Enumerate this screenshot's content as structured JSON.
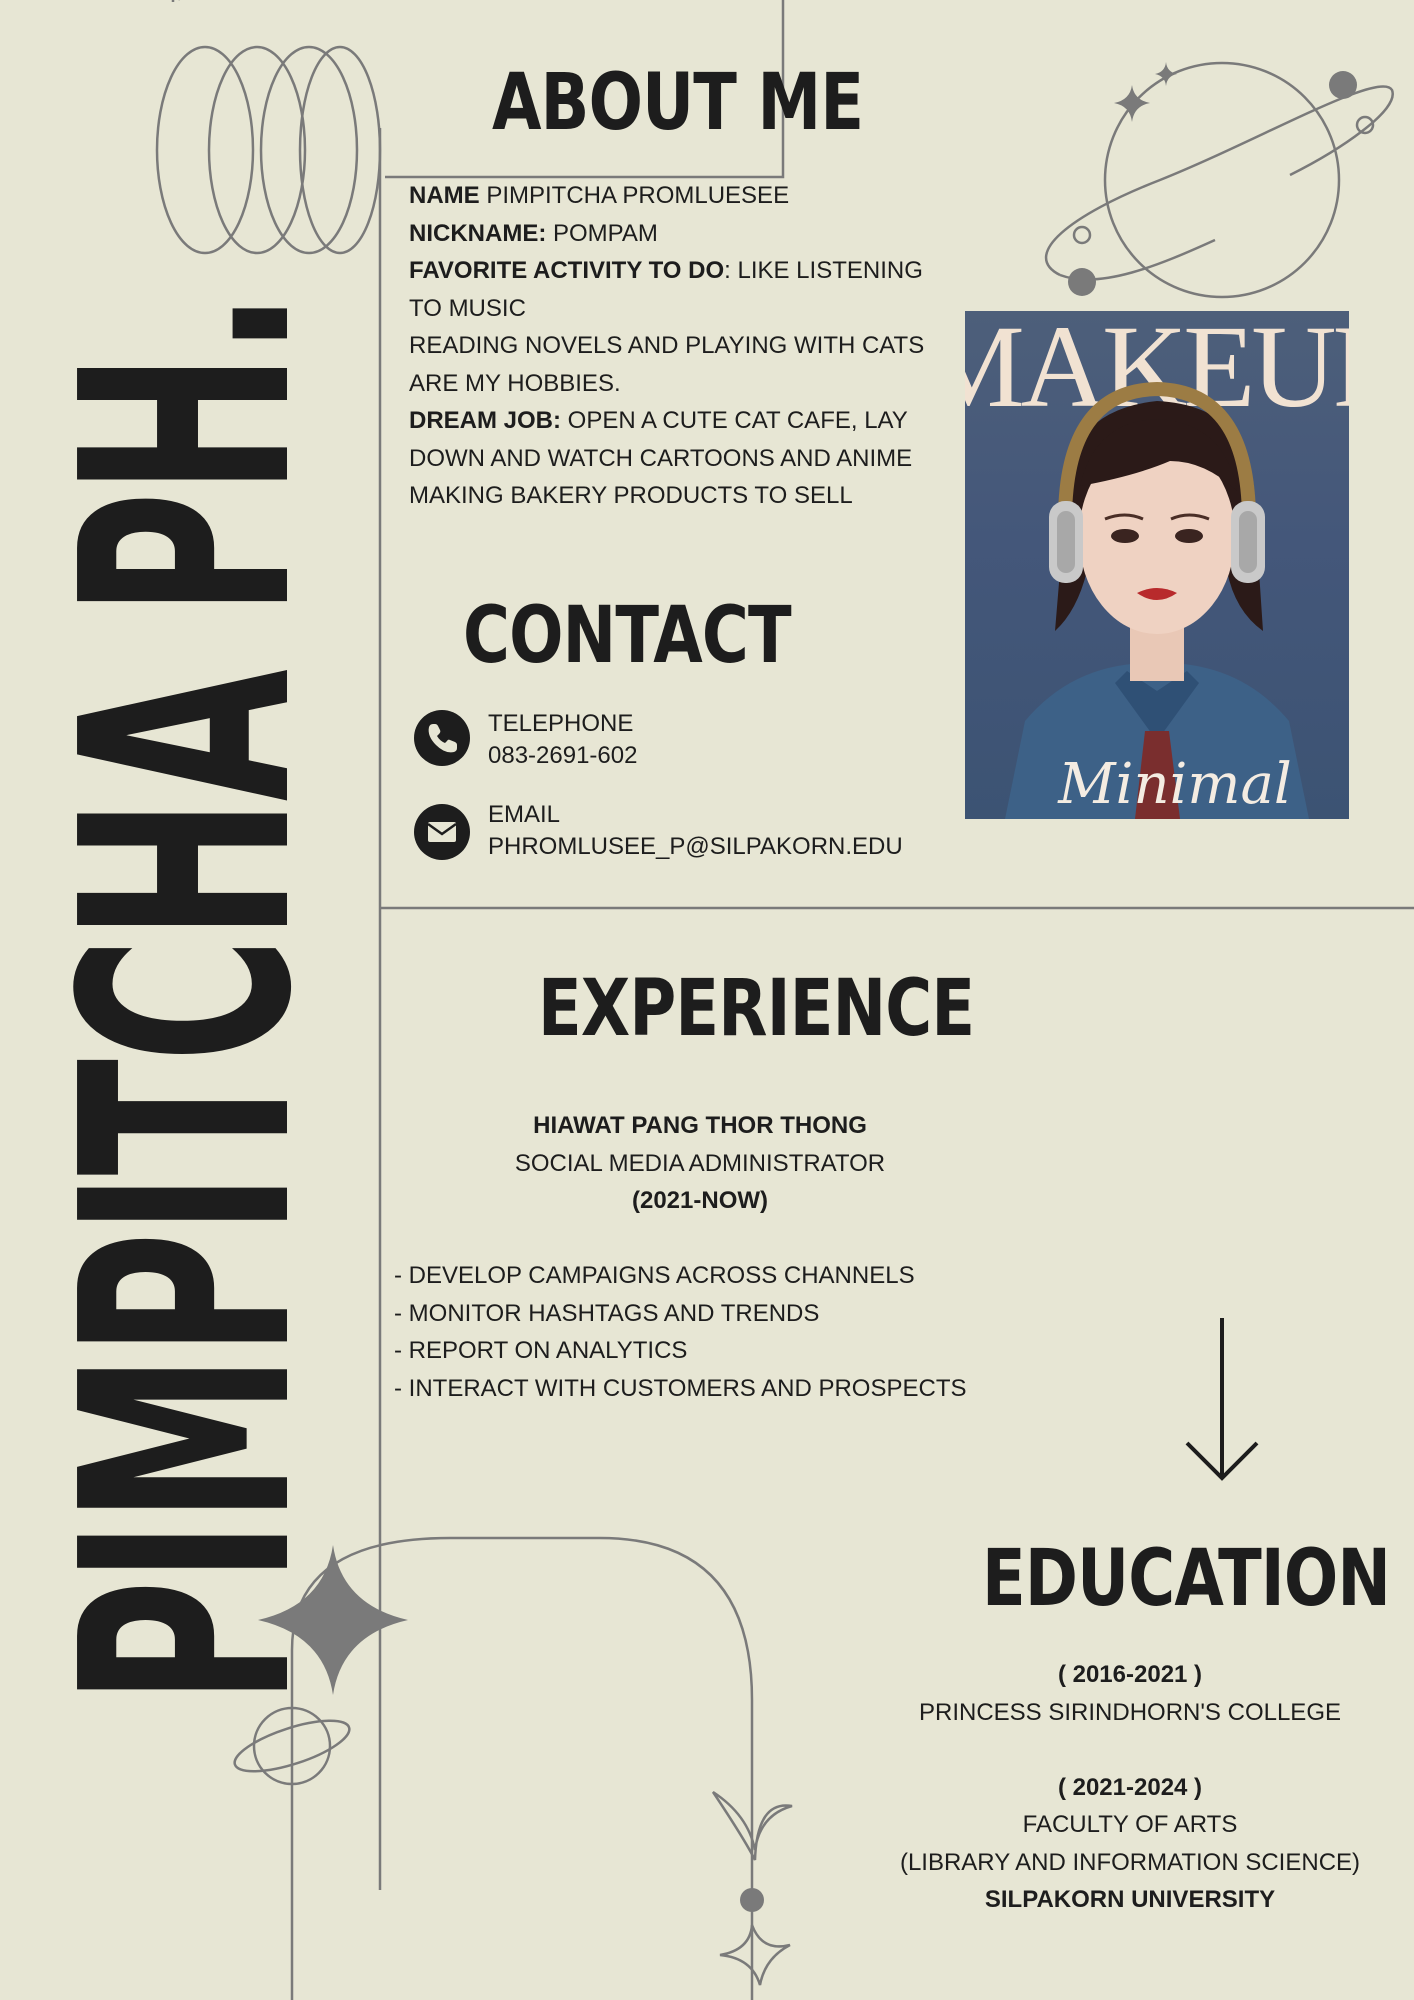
{
  "name_vertical": "PIMPITCHA PH.",
  "about": {
    "heading": "ABOUT ME",
    "name_label": "NAME",
    "name_value": " PIMPITCHA PROMLUESEE",
    "nickname_label": "NICKNAME:",
    "nickname_value": " POMPAM",
    "activity_label": "FAVORITE ACTIVITY TO DO",
    "activity_line1": ": LIKE LISTENING",
    "activity_line2": "TO MUSIC",
    "hobbies_line1": "READING NOVELS AND PLAYING WITH CATS",
    "hobbies_line2": "ARE MY HOBBIES.",
    "dream_label": "DREAM JOB:",
    "dream_line1": " OPEN A CUTE CAT CAFE, LAY",
    "dream_line2": "DOWN AND WATCH CARTOONS AND ANIME",
    "dream_line3": "MAKING BAKERY PRODUCTS TO SELL"
  },
  "contact": {
    "heading": "CONTACT",
    "phone_label": "TELEPHONE",
    "phone_value": "083-2691-602",
    "email_label": "EMAIL",
    "email_value": "PHROMLUSEE_P@SILPAKORN.EDU"
  },
  "photo": {
    "title": "MAKEUP",
    "caption": "Minimal"
  },
  "experience": {
    "heading": "EXPERIENCE",
    "company": "HIAWAT PANG THOR THONG",
    "role": "SOCIAL MEDIA ADMINISTRATOR",
    "period": "(2021-NOW)",
    "bullets": [
      "- DEVELOP CAMPAIGNS ACROSS CHANNELS",
      "- MONITOR HASHTAGS AND TRENDS",
      "- REPORT ON ANALYTICS",
      "- INTERACT WITH CUSTOMERS AND PROSPECTS"
    ]
  },
  "education": {
    "heading": "EDUCATION",
    "period1": "( 2016-2021 )",
    "school1": "PRINCESS SIRINDHORN'S COLLEGE",
    "period2": "( 2021-2024 )",
    "faculty": "FACULTY OF ARTS",
    "program": "(LIBRARY AND INFORMATION SCIENCE)",
    "university": "SILPAKORN UNIVERSITY"
  },
  "icons": {
    "phone": "phone-icon",
    "email": "envelope-icon",
    "arrow": "arrow-down-icon",
    "star": "sparkle-star-icon",
    "planet": "planet-icon"
  },
  "colors": {
    "background": "#e7e6d4",
    "ink": "#1d1d1d",
    "line": "#7a7a7a"
  }
}
